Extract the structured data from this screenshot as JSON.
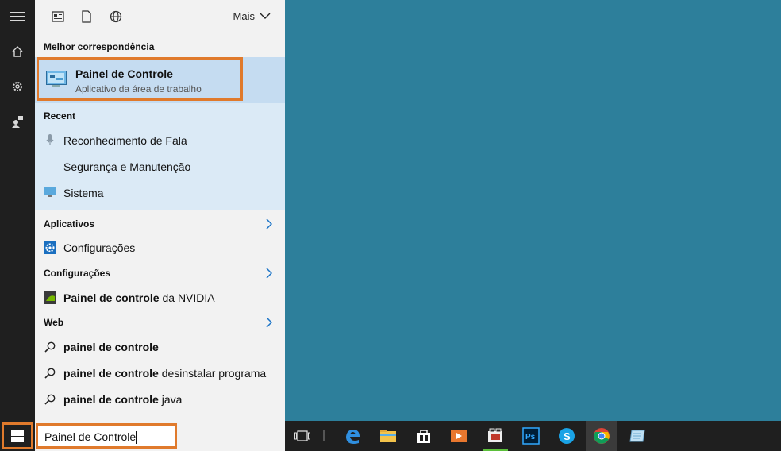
{
  "topbar": {
    "more_label": "Mais"
  },
  "sections": {
    "best_match": "Melhor correspondência",
    "recent": "Recent",
    "apps": "Aplicativos",
    "settings": "Configurações",
    "web": "Web"
  },
  "best_match": {
    "title": "Painel de Controle",
    "subtitle": "Aplicativo da área de trabalho"
  },
  "recent": [
    "Reconhecimento de Fala",
    "Segurança e Manutenção",
    "Sistema"
  ],
  "apps": [
    "Configurações"
  ],
  "settings": [
    {
      "bold": "Painel de controle",
      "rest": " da NVIDIA"
    }
  ],
  "web": [
    {
      "bold": "painel de controle",
      "rest": ""
    },
    {
      "bold": "painel de controle",
      "rest": " desinstalar programa"
    },
    {
      "bold": "painel de controle",
      "rest": " java"
    }
  ],
  "search": {
    "value": "Painel de Controle"
  },
  "colors": {
    "desktop": "#2d7f9b",
    "highlight": "#e07a2c",
    "selected": "#c5dcf1",
    "taskbar": "#1f1f1f"
  },
  "taskbar_icons": [
    "task-view-icon",
    "edge-icon",
    "file-explorer-icon",
    "store-icon",
    "media-player-icon",
    "video-editor-icon",
    "photoshop-icon",
    "skype-icon",
    "chrome-icon",
    "notepad-icon"
  ]
}
